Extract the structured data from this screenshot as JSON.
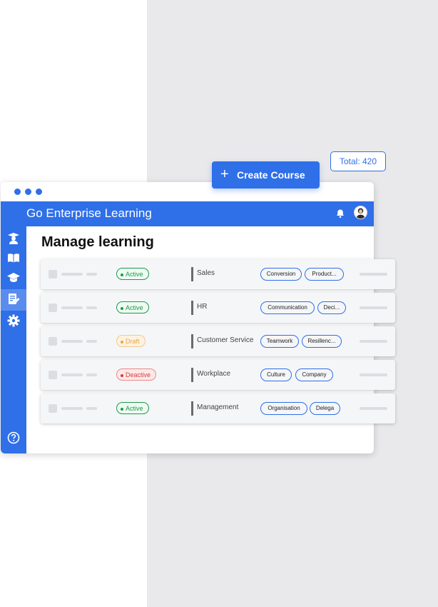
{
  "app": {
    "title": "Go Enterprise Learning"
  },
  "page": {
    "title": "Manage learning"
  },
  "actions": {
    "create_course": "Create Course"
  },
  "total_badge": "Total: 420",
  "sidebar": {
    "items": [
      {
        "icon": "graduate-icon"
      },
      {
        "icon": "book-icon"
      },
      {
        "icon": "mortarboard-icon"
      },
      {
        "icon": "edit-document-icon",
        "active": true
      },
      {
        "icon": "gear-icon"
      },
      {
        "icon": "help-icon"
      }
    ]
  },
  "courses": [
    {
      "status": "Active",
      "category": "Sales",
      "tags": [
        "Conversion",
        "Product..."
      ]
    },
    {
      "status": "Active",
      "category": "HR",
      "tags": [
        "Communication",
        "Deci..."
      ]
    },
    {
      "status": "Draft",
      "category": "Customer Service",
      "tags": [
        "Teamwork",
        "Resillenc..."
      ]
    },
    {
      "status": "Deactive",
      "category": "Workplace",
      "tags": [
        "Culture",
        "Company"
      ]
    },
    {
      "status": "Active",
      "category": "Management",
      "tags": [
        "Organisation",
        "Delega"
      ]
    }
  ],
  "colors": {
    "brand": "#2f6fe8",
    "active": "#1d9a4d",
    "draft": "#f0a53a",
    "deactive": "#d63c3c"
  }
}
